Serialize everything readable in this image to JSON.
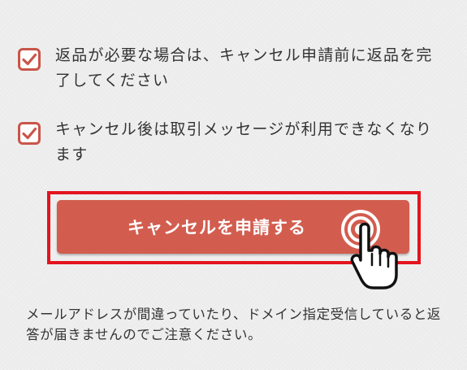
{
  "checklist": [
    {
      "checked": true,
      "text": "返品が必要な場合は、キャンセル申請前に返品を完了してください"
    },
    {
      "checked": true,
      "text": "キャンセル後は取引メッセージが利用できなくなります"
    }
  ],
  "cancel_button": {
    "label": "キャンセルを申請する"
  },
  "notice": {
    "text": "メールアドレスが間違っていたり、ドメイン指定受信していると返答が届きませんのでご注意ください。"
  },
  "icons": {
    "checkbox": "check-icon",
    "tap": "tap-ripple-icon",
    "pointer": "pointing-hand-icon"
  },
  "colors": {
    "accent": "#d25d4f",
    "checkbox_border": "#c9554a",
    "highlight_frame": "#e3141e",
    "text": "#333333",
    "background": "#f0f0f0"
  }
}
